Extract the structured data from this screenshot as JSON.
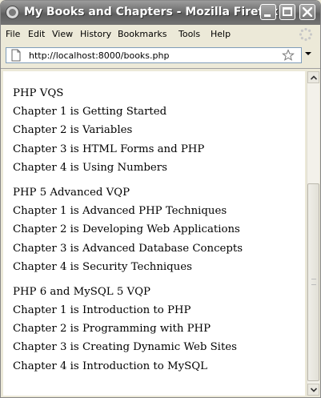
{
  "window": {
    "title": "My Books and Chapters - Mozilla Firefox"
  },
  "menubar": {
    "items": [
      {
        "label": "File"
      },
      {
        "label": "Edit"
      },
      {
        "label": "View"
      },
      {
        "label": "History"
      },
      {
        "label": "Bookmarks"
      },
      {
        "label": "Tools"
      },
      {
        "label": "Help"
      }
    ]
  },
  "navbar": {
    "url": "http://localhost:8000/books.php"
  },
  "content": {
    "books": [
      {
        "title": "PHP VQS",
        "chapters": [
          "Chapter 1 is Getting Started",
          "Chapter 2 is Variables",
          "Chapter 3 is HTML Forms and PHP",
          "Chapter 4 is Using Numbers"
        ]
      },
      {
        "title": "PHP 5 Advanced VQP",
        "chapters": [
          "Chapter 1 is Advanced PHP Techniques",
          "Chapter 2 is Developing Web Applications",
          "Chapter 3 is Advanced Database Concepts",
          "Chapter 4 is Security Techniques"
        ]
      },
      {
        "title": "PHP 6 and MySQL 5 VQP",
        "chapters": [
          "Chapter 1 is Introduction to PHP",
          "Chapter 2 is Programming with PHP",
          "Chapter 3 is Creating Dynamic Web Sites",
          "Chapter 4 is Introduction to MySQL"
        ]
      }
    ]
  },
  "icons": {
    "app": "firefox-icon",
    "minimize": "minimize-icon",
    "maximize": "maximize-icon",
    "close": "close-icon",
    "throbber": "throbber-icon",
    "page": "page-icon",
    "bookmark": "star-icon",
    "dropdown": "chevron-down-icon"
  },
  "colors": {
    "titlebar": "#6e6e6e",
    "chrome": "#ece9d8",
    "content_bg": "#ffffff"
  }
}
